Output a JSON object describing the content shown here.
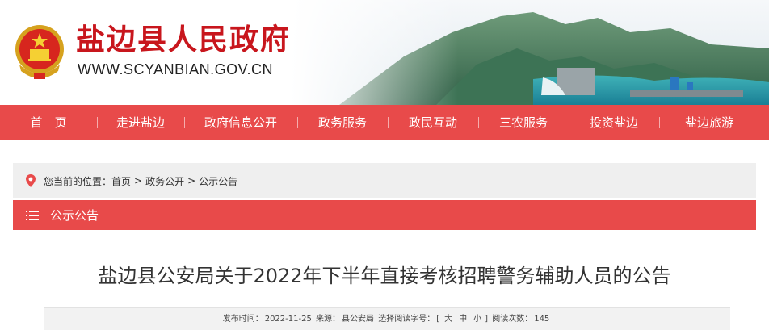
{
  "header": {
    "site_title": "盐边县人民政府",
    "site_url": "WWW.SCYANBIAN.GOV.CN",
    "emblem_icon": "national-emblem-icon",
    "brand_red": "#c8161d"
  },
  "nav": {
    "color": "#e84a4a",
    "items": [
      {
        "label": "首　页"
      },
      {
        "label": "走进盐边"
      },
      {
        "label": "政府信息公开"
      },
      {
        "label": "政务服务"
      },
      {
        "label": "政民互动"
      },
      {
        "label": "三农服务"
      },
      {
        "label": "投资盐边"
      },
      {
        "label": "盐边旅游"
      }
    ]
  },
  "breadcrumb": {
    "icon": "location-pin-icon",
    "prefix": "您当前的位置：",
    "items": [
      "首页",
      "政务公开",
      "公示公告"
    ],
    "separator": ">"
  },
  "section": {
    "icon": "list-icon",
    "title": "公示公告"
  },
  "article": {
    "title": "盐边县公安局关于2022年下半年直接考核招聘警务辅助人员的公告",
    "meta": {
      "date_label": "发布时间：",
      "date": "2022-11-25",
      "source_label": "来源：",
      "source": "县公安局",
      "font_label": "选择阅读字号：",
      "bracket_open": "[",
      "font_large": "大",
      "font_medium": "中",
      "font_small": "小",
      "bracket_close": "]",
      "views_label": "阅读次数：",
      "views": "145"
    }
  }
}
